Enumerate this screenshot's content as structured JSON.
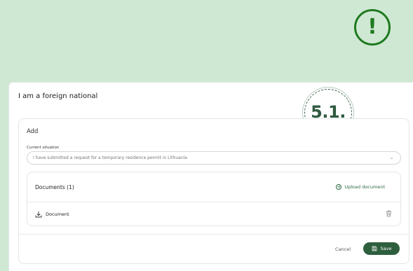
{
  "alert": {
    "glyph": "!"
  },
  "panel": {
    "title": "I am a foreign national"
  },
  "step": {
    "label": "5.1."
  },
  "form": {
    "heading": "Add",
    "current_situation_label": "Current situation",
    "current_situation_value": "I have submitted a request for a temporary residence permit in Lithuania"
  },
  "documents": {
    "heading": "Documents (1)",
    "upload_label": "Upload document",
    "items": [
      {
        "name": "Document"
      }
    ]
  },
  "actions": {
    "cancel_label": "Cancel",
    "save_label": "Save"
  },
  "colors": {
    "background": "#cfe8d3",
    "accent": "#2d5e3d",
    "alert": "#1f7a1f"
  }
}
